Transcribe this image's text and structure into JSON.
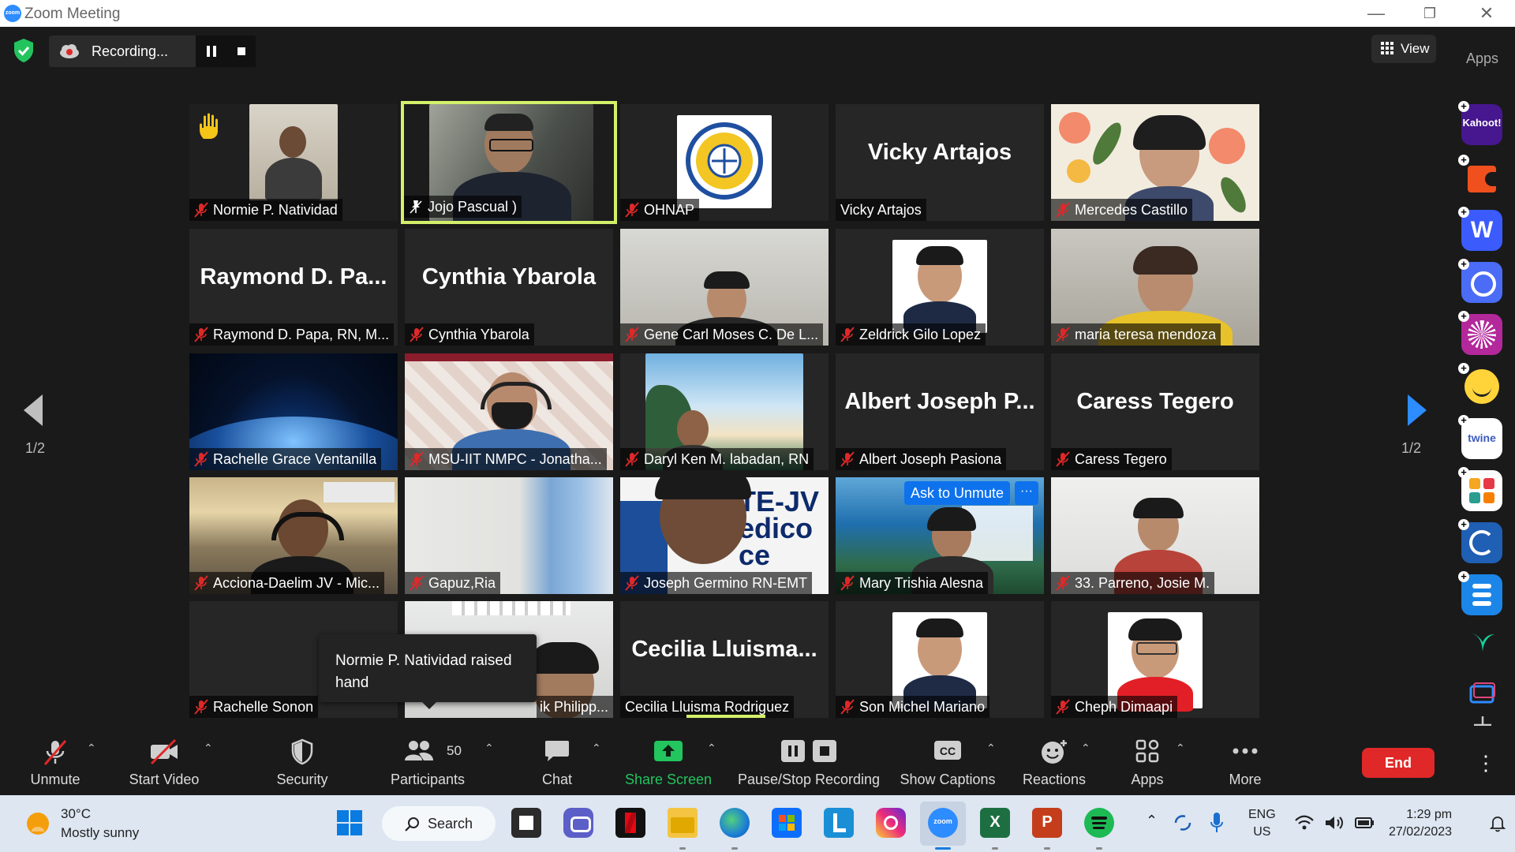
{
  "window": {
    "title": "Zoom Meeting",
    "logo_text": "zoom"
  },
  "recording": {
    "label": "Recording..."
  },
  "view_button": {
    "label": "View"
  },
  "apps_label": "Apps",
  "pager": {
    "left": "1/2",
    "right": "1/2"
  },
  "tiles": [
    {
      "name": "Normie P. Natividad",
      "raised_hand": true
    },
    {
      "name": "Jojo Pascual )",
      "active_speaker": true,
      "pinned": true
    },
    {
      "name": "OHNAP"
    },
    {
      "name": "Vicky Artajos",
      "display_name": "Vicky Artajos",
      "video": false
    },
    {
      "name": "Mercedes Castillo"
    },
    {
      "name": "Raymond D. Papa, RN, M...",
      "display_name": "Raymond  D.  Pa...",
      "video": false
    },
    {
      "name": "Cynthia Ybarola",
      "display_name": "Cynthia Ybarola",
      "video": false
    },
    {
      "name": "Gene Carl Moses C. De L..."
    },
    {
      "name": "Zeldrick Gilo Lopez"
    },
    {
      "name": "maria teresa mendoza"
    },
    {
      "name": "Rachelle Grace Ventanilla"
    },
    {
      "name": "MSU-IIT NMPC - Jonatha..."
    },
    {
      "name": "Daryl Ken M. labadan, RN"
    },
    {
      "name": "Albert Joseph Pasiona",
      "display_name": "Albert Joseph P...",
      "video": false
    },
    {
      "name": "Caress Tegero",
      "display_name": "Caress Tegero",
      "video": false
    },
    {
      "name": "Acciona-Daelim JV - Mic..."
    },
    {
      "name": "Gapuz,Ria"
    },
    {
      "name": "Joseph Germino RN-EMT",
      "overlay_text": "TE-JV\nedico\nce"
    },
    {
      "name": "Mary Trishia Alesna"
    },
    {
      "name": "33. Parreno, Josie M."
    },
    {
      "name": "Rachelle Sonon",
      "video": false
    },
    {
      "name": "ik Philipp..."
    },
    {
      "name": "Cecilia Lluisma Rodriguez",
      "display_name": "Cecilia  Lluisma...",
      "video": false
    },
    {
      "name": "Son Michel Mariano"
    },
    {
      "name": "Cheph Dimaapi"
    }
  ],
  "ask_to_unmute": {
    "label": "Ask to Unmute",
    "more": "···"
  },
  "tooltip": {
    "text": "Normie P. Natividad raised hand"
  },
  "toolbar": {
    "unmute": "Unmute",
    "start_video": "Start Video",
    "security": "Security",
    "participants": "Participants",
    "participants_count": "50",
    "chat": "Chat",
    "share_screen": "Share Screen",
    "pause_stop_recording": "Pause/Stop Recording",
    "show_captions": "Show Captions",
    "cc": "CC",
    "reactions": "Reactions",
    "apps": "Apps",
    "more": "More",
    "end": "End"
  },
  "side_apps": [
    {
      "name": "kahoot",
      "text": "Kahoot!",
      "color": "#46178f"
    },
    {
      "name": "slido-like",
      "text": "",
      "color": "#f0501e"
    },
    {
      "name": "wooclap",
      "text": "W",
      "color": "#3b5bfd"
    },
    {
      "name": "app-circle",
      "text": "",
      "color": "#4a6cf7"
    },
    {
      "name": "app-purple",
      "text": "",
      "color": "#b3289b"
    },
    {
      "name": "app-emoji",
      "text": "",
      "color": "#ffd43b"
    },
    {
      "name": "twine",
      "text": "twine",
      "color": "#ffffff"
    },
    {
      "name": "app-blocks",
      "text": "",
      "color": "#ffffff"
    },
    {
      "name": "app-sync",
      "text": "",
      "color": "#1f5fb4"
    },
    {
      "name": "app-e",
      "text": "",
      "color": "#1b86e8"
    }
  ],
  "taskbar": {
    "weather_temp": "30°C",
    "weather_desc": "Mostly sunny",
    "search": "Search",
    "lang1": "ENG",
    "lang2": "US",
    "time": "1:29 pm",
    "date": "27/02/2023"
  },
  "colors": {
    "active_speaker": "#d4f06a",
    "end_button": "#e02828",
    "share_screen": "#22c55e",
    "muted_mic": "#e02828",
    "zoom_blue": "#2d8cff"
  }
}
